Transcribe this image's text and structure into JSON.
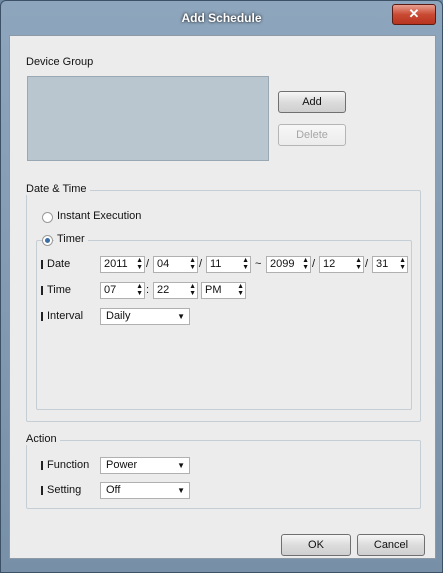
{
  "window": {
    "title": "Add Schedule",
    "close_glyph": "✕"
  },
  "device_group": {
    "label": "Device Group",
    "add": "Add",
    "delete": "Delete"
  },
  "datetime": {
    "label": "Date & Time",
    "instant": "Instant Execution",
    "timer": "Timer",
    "date_label": "Date",
    "start_year": "2011",
    "start_month": "04",
    "start_day": "11",
    "range_sep": "~",
    "end_year": "2099",
    "end_month": "12",
    "end_day": "31",
    "date_sep": "/",
    "time_label": "Time",
    "hour": "07",
    "minute": "22",
    "time_sep": ":",
    "ampm": "PM",
    "interval_label": "Interval",
    "interval": "Daily"
  },
  "action": {
    "label": "Action",
    "function_label": "Function",
    "function": "Power",
    "setting_label": "Setting",
    "setting": "Off"
  },
  "footer": {
    "ok": "OK",
    "cancel": "Cancel"
  },
  "icons": {
    "spinner": "spin-arrows-icon",
    "dropdown": "chevron-down-icon"
  }
}
